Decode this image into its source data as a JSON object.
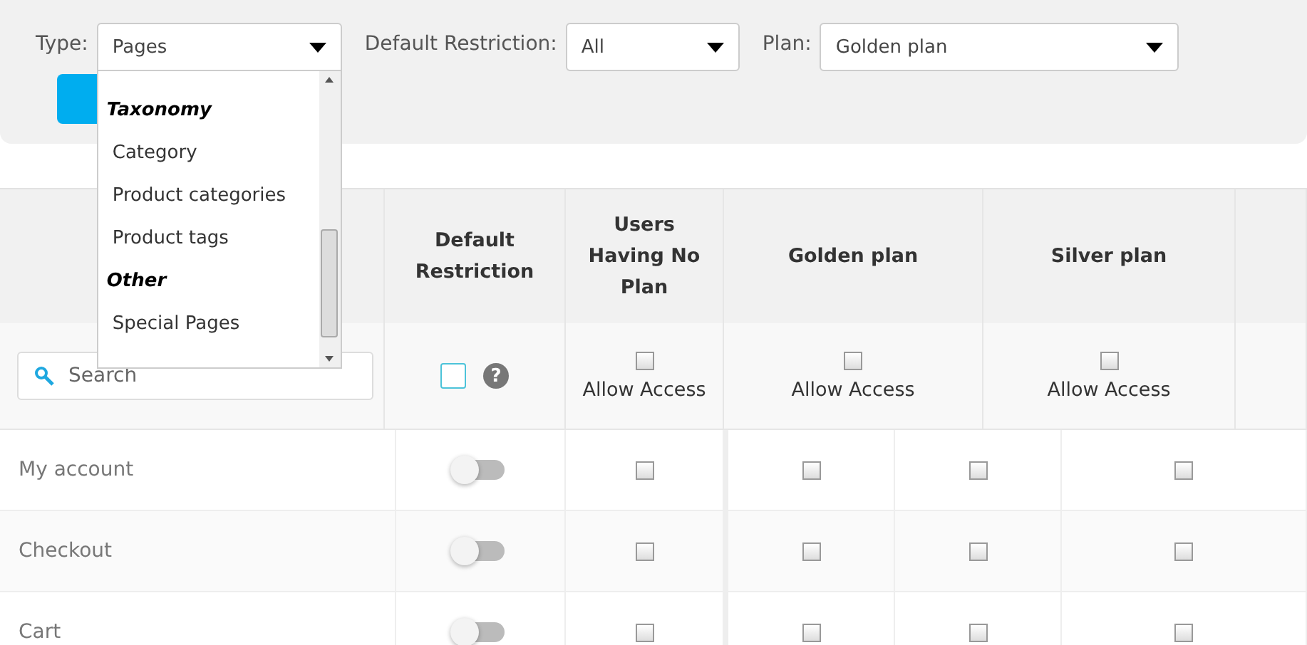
{
  "filters": {
    "type": {
      "label": "Type:",
      "value": "Pages",
      "expanded": true,
      "groups": [
        {
          "title": "Taxonomy",
          "options": [
            "Category",
            "Product categories",
            "Product tags"
          ]
        },
        {
          "title": "Other",
          "options": [
            "Special Pages"
          ]
        }
      ]
    },
    "default_restriction": {
      "label": "Default Restriction:",
      "value": "All"
    },
    "plan": {
      "label": "Plan:",
      "value": "Golden plan"
    }
  },
  "table": {
    "columns": [
      {
        "title": "Default Restriction"
      },
      {
        "title": "Users Having No Plan"
      },
      {
        "title": "Golden plan"
      },
      {
        "title": "Silver plan"
      }
    ],
    "search": {
      "placeholder": "Search"
    },
    "default_all": {
      "checked": false
    },
    "help": "?",
    "access": [
      {
        "label": "Allow Access",
        "checked": false
      },
      {
        "label": "Allow Access",
        "checked": false
      },
      {
        "label": "Allow Access",
        "checked": false
      }
    ],
    "rows": [
      {
        "name": "My account",
        "on": false,
        "checks": [
          false,
          false,
          false,
          false
        ]
      },
      {
        "name": "Checkout",
        "on": false,
        "checks": [
          false,
          false,
          false,
          false
        ]
      },
      {
        "name": "Cart",
        "on": false,
        "checks": [
          false,
          false,
          false,
          false
        ]
      }
    ]
  }
}
